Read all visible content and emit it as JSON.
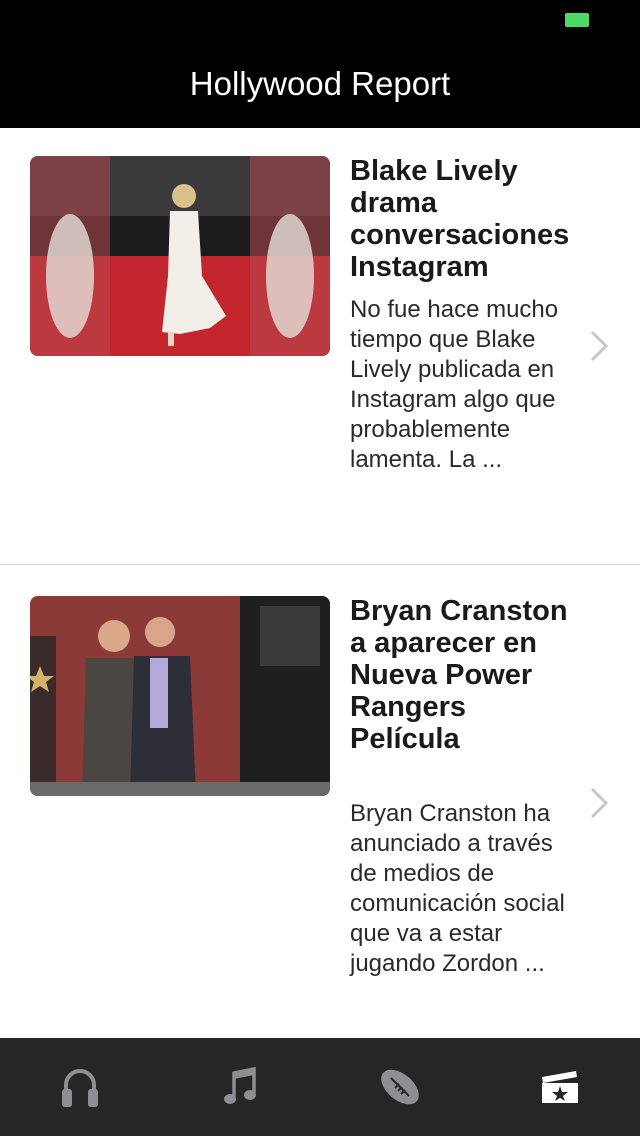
{
  "status_bar": {
    "battery_color": "#4cd964"
  },
  "nav": {
    "title": "Hollywood Report"
  },
  "articles": [
    {
      "title": "Blake Lively drama conversaciones Instagram",
      "summary": "No fue hace mucho tiempo que Blake Lively publicada en Instagram algo que probablemente lamenta. La ..."
    },
    {
      "title": "Bryan Cranston a aparecer en Nueva Power Rangers Película",
      "summary": "Bryan Cranston ha anunciado a través de medios de comunicación social que va a estar jugando Zordon ..."
    }
  ],
  "tab_bar": {
    "background": "#262626",
    "tabs": [
      {
        "icon": "headphones-icon",
        "selected": false
      },
      {
        "icon": "music-note-icon",
        "selected": false
      },
      {
        "icon": "football-icon",
        "selected": false
      },
      {
        "icon": "movie-ticket-icon",
        "selected": true
      }
    ]
  }
}
